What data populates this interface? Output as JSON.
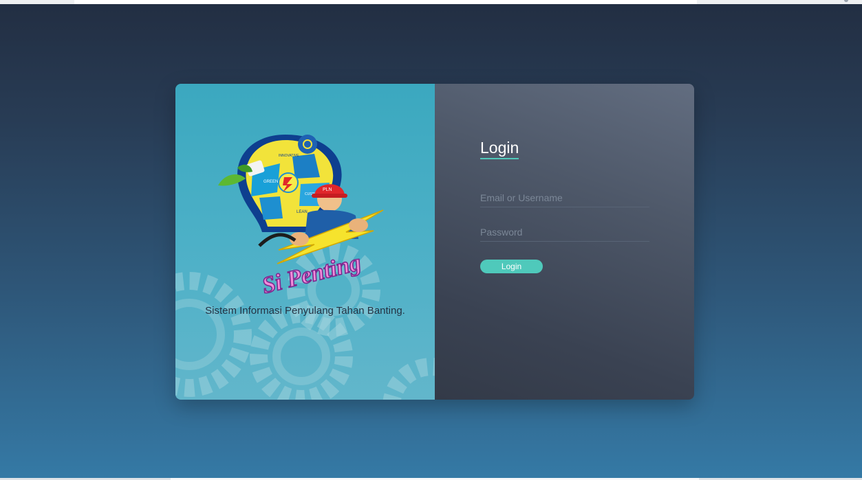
{
  "brand": {
    "logo_text": "Si Penting",
    "puzzle_labels": [
      "INNOVATIVE",
      "GREEN",
      "CUSTOMER FOCUSED",
      "LEAN"
    ],
    "helmet_text": "PLN",
    "tagline": "Sistem Informasi Penyulang Tahan Banting."
  },
  "login": {
    "title": "Login",
    "username_placeholder": "Email or Username",
    "password_placeholder": "Password",
    "button_label": "Login"
  },
  "colors": {
    "accent": "#4fc9bb",
    "left_panel": "#3ba8bf",
    "right_panel": "#4e5869",
    "background_top": "#222e42",
    "background_bottom": "#357aa6"
  }
}
